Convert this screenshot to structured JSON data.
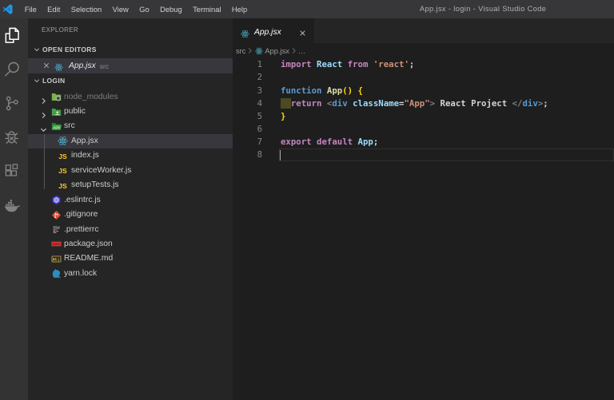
{
  "window": {
    "title": "App.jsx - login - Visual Studio Code"
  },
  "menu": {
    "items": [
      "File",
      "Edit",
      "Selection",
      "View",
      "Go",
      "Debug",
      "Terminal",
      "Help"
    ]
  },
  "activity_bar": {
    "items": [
      {
        "icon": "files-icon",
        "active": true
      },
      {
        "icon": "search-icon",
        "active": false
      },
      {
        "icon": "source-control-icon",
        "active": false
      },
      {
        "icon": "debug-icon",
        "active": false
      },
      {
        "icon": "extensions-icon",
        "active": false
      },
      {
        "icon": "docker-icon",
        "active": false
      }
    ]
  },
  "sidebar": {
    "title": "EXPLORER",
    "open_editors_section": "OPEN EDITORS",
    "open_editor": {
      "name": "App.jsx",
      "description": "src",
      "icon": "react-icon"
    },
    "folder_section": "LOGIN",
    "tree": [
      {
        "name": "node_modules",
        "icon": "folder-node-icon",
        "level": 1,
        "chevron": "right",
        "dimmed": true,
        "selected": false
      },
      {
        "name": "public",
        "icon": "folder-public-icon",
        "level": 1,
        "chevron": "right",
        "dimmed": false,
        "selected": false
      },
      {
        "name": "src",
        "icon": "folder-src-open-icon",
        "level": 1,
        "chevron": "down",
        "dimmed": false,
        "selected": false
      },
      {
        "name": "App.jsx",
        "icon": "react-icon",
        "level": 2,
        "chevron": "none",
        "dimmed": false,
        "selected": true
      },
      {
        "name": "index.js",
        "icon": "js-icon",
        "level": 2,
        "chevron": "none",
        "dimmed": false,
        "selected": false
      },
      {
        "name": "serviceWorker.js",
        "icon": "js-icon",
        "level": 2,
        "chevron": "none",
        "dimmed": false,
        "selected": false
      },
      {
        "name": "setupTests.js",
        "icon": "js-icon",
        "level": 2,
        "chevron": "none",
        "dimmed": false,
        "selected": false
      },
      {
        "name": ".eslintrc.js",
        "icon": "eslint-icon",
        "level": 1,
        "chevron": "none",
        "dimmed": false,
        "selected": false
      },
      {
        "name": ".gitignore",
        "icon": "git-icon",
        "level": 1,
        "chevron": "none",
        "dimmed": false,
        "selected": false
      },
      {
        "name": ".prettierrc",
        "icon": "prettier-icon",
        "level": 1,
        "chevron": "none",
        "dimmed": false,
        "selected": false
      },
      {
        "name": "package.json",
        "icon": "npm-icon",
        "level": 1,
        "chevron": "none",
        "dimmed": false,
        "selected": false
      },
      {
        "name": "README.md",
        "icon": "readme-icon",
        "level": 1,
        "chevron": "none",
        "dimmed": false,
        "selected": false
      },
      {
        "name": "yarn.lock",
        "icon": "yarn-icon",
        "level": 1,
        "chevron": "none",
        "dimmed": false,
        "selected": false
      }
    ]
  },
  "editor": {
    "tab": {
      "label": "App.jsx",
      "icon": "react-icon"
    },
    "breadcrumb": [
      {
        "label": "src"
      },
      {
        "label": "App.jsx",
        "icon": "react-icon"
      },
      {
        "label": "…"
      }
    ],
    "code": {
      "lines": [
        {
          "num": "1",
          "tokens": [
            [
              "kw",
              "import"
            ],
            [
              "pln",
              " "
            ],
            [
              "var",
              "React"
            ],
            [
              "pln",
              " "
            ],
            [
              "kw",
              "from"
            ],
            [
              "pln",
              " "
            ],
            [
              "str",
              "'react'"
            ],
            [
              "pln",
              ";"
            ]
          ]
        },
        {
          "num": "2",
          "tokens": []
        },
        {
          "num": "3",
          "tokens": [
            [
              "kw2",
              "function"
            ],
            [
              "pln",
              " "
            ],
            [
              "fn",
              "App"
            ],
            [
              "brk",
              "()"
            ],
            [
              "pln",
              " "
            ],
            [
              "brk",
              "{"
            ]
          ]
        },
        {
          "num": "4",
          "tokens": [
            [
              "box",
              "  "
            ],
            [
              "kw",
              "return"
            ],
            [
              "pln",
              " "
            ],
            [
              "ang",
              "<"
            ],
            [
              "tag",
              "div"
            ],
            [
              "pln",
              " "
            ],
            [
              "attr",
              "className"
            ],
            [
              "pln",
              "="
            ],
            [
              "str",
              "\"App\""
            ],
            [
              "ang",
              ">"
            ],
            [
              "pln",
              " React Project "
            ],
            [
              "ang",
              "</"
            ],
            [
              "tag",
              "div"
            ],
            [
              "ang",
              ">"
            ],
            [
              "pln",
              ";"
            ]
          ]
        },
        {
          "num": "5",
          "tokens": [
            [
              "brk",
              "}"
            ]
          ]
        },
        {
          "num": "6",
          "tokens": []
        },
        {
          "num": "7",
          "tokens": [
            [
              "kw",
              "export"
            ],
            [
              "pln",
              " "
            ],
            [
              "kw",
              "default"
            ],
            [
              "pln",
              " "
            ],
            [
              "var",
              "App"
            ],
            [
              "pln",
              ";"
            ]
          ]
        },
        {
          "num": "8",
          "tokens": [],
          "current": true
        }
      ]
    }
  },
  "colors": {
    "titlebar": "#37373a",
    "activity_bar": "#333333",
    "sidebar": "#252526",
    "editor": "#1e1e1e",
    "tab_strip": "#252526",
    "selection": "#37373d",
    "accent_react": "#53c1de",
    "keyword": "#c586c0",
    "keyword2": "#569cd6",
    "string": "#ce9178",
    "bracket": "#ffd700",
    "line_number": "#858585"
  }
}
